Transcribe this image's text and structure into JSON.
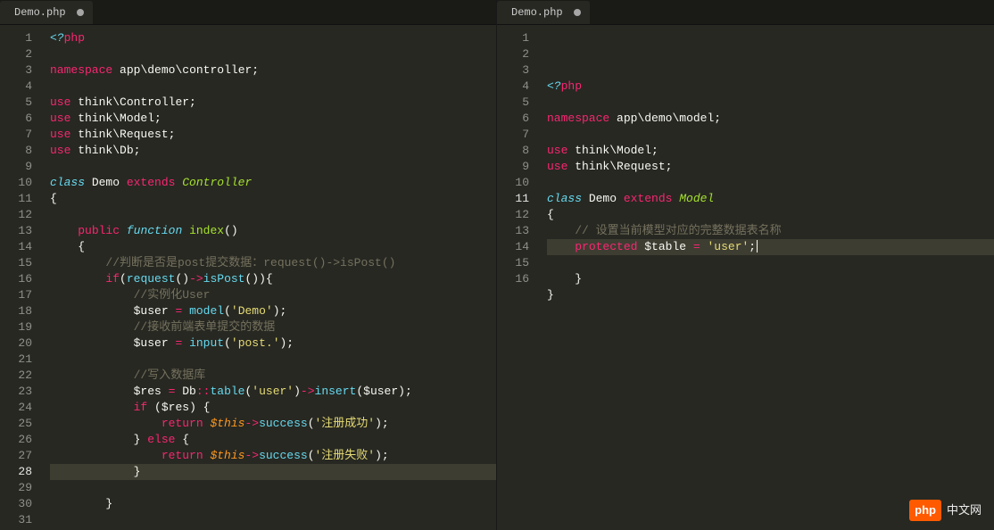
{
  "left": {
    "tab": {
      "label": "Demo.php",
      "dirty": true
    },
    "activeLine": 28,
    "lines": [
      [
        [
          "kw",
          "<?"
        ],
        [
          "kw2",
          "php"
        ]
      ],
      [],
      [
        [
          "kw2",
          "namespace"
        ],
        [
          "name",
          " app"
        ],
        [
          "punc",
          "\\"
        ],
        [
          "name",
          "demo"
        ],
        [
          "punc",
          "\\"
        ],
        [
          "name",
          "controller"
        ],
        [
          "punc",
          ";"
        ]
      ],
      [],
      [
        [
          "kw2",
          "use"
        ],
        [
          "name",
          " think"
        ],
        [
          "punc",
          "\\"
        ],
        [
          "name",
          "Controller"
        ],
        [
          "punc",
          ";"
        ]
      ],
      [
        [
          "kw2",
          "use"
        ],
        [
          "name",
          " think"
        ],
        [
          "punc",
          "\\"
        ],
        [
          "name",
          "Model"
        ],
        [
          "punc",
          ";"
        ]
      ],
      [
        [
          "kw2",
          "use"
        ],
        [
          "name",
          " think"
        ],
        [
          "punc",
          "\\"
        ],
        [
          "name",
          "Request"
        ],
        [
          "punc",
          ";"
        ]
      ],
      [
        [
          "kw2",
          "use"
        ],
        [
          "name",
          " think"
        ],
        [
          "punc",
          "\\"
        ],
        [
          "name",
          "Db"
        ],
        [
          "punc",
          ";"
        ]
      ],
      [],
      [
        [
          "kw",
          "class "
        ],
        [
          "name",
          "Demo "
        ],
        [
          "kw2",
          "extends "
        ],
        [
          "ext",
          "Controller"
        ]
      ],
      [
        [
          "punc",
          "{"
        ]
      ],
      [],
      [
        [
          "name",
          "    "
        ],
        [
          "kw2",
          "public"
        ],
        [
          "name",
          " "
        ],
        [
          "fnkw",
          "function"
        ],
        [
          "name",
          " "
        ],
        [
          "fn",
          "index"
        ],
        [
          "punc",
          "()"
        ]
      ],
      [
        [
          "punc",
          "    {"
        ]
      ],
      [
        [
          "name",
          "        "
        ],
        [
          "com",
          "//判断是否是post提交数据：request()->isPost()"
        ]
      ],
      [
        [
          "name",
          "        "
        ],
        [
          "kw2",
          "if"
        ],
        [
          "punc",
          "("
        ],
        [
          "call",
          "request"
        ],
        [
          "punc",
          "()"
        ],
        [
          "op",
          "->"
        ],
        [
          "call",
          "isPost"
        ],
        [
          "punc",
          "()){"
        ]
      ],
      [
        [
          "name",
          "            "
        ],
        [
          "com",
          "//实例化User"
        ]
      ],
      [
        [
          "name",
          "            "
        ],
        [
          "var",
          "$user "
        ],
        [
          "op",
          "="
        ],
        [
          "name",
          " "
        ],
        [
          "call",
          "model"
        ],
        [
          "punc",
          "("
        ],
        [
          "str",
          "'Demo'"
        ],
        [
          "punc",
          ");"
        ]
      ],
      [
        [
          "name",
          "            "
        ],
        [
          "com",
          "//接收前端表单提交的数据"
        ]
      ],
      [
        [
          "name",
          "            "
        ],
        [
          "var",
          "$user "
        ],
        [
          "op",
          "="
        ],
        [
          "name",
          " "
        ],
        [
          "call",
          "input"
        ],
        [
          "punc",
          "("
        ],
        [
          "str",
          "'post.'"
        ],
        [
          "punc",
          ");"
        ]
      ],
      [],
      [
        [
          "name",
          "            "
        ],
        [
          "com",
          "//写入数据库"
        ]
      ],
      [
        [
          "name",
          "            "
        ],
        [
          "var",
          "$res "
        ],
        [
          "op",
          "="
        ],
        [
          "name",
          " Db"
        ],
        [
          "op",
          "::"
        ],
        [
          "call",
          "table"
        ],
        [
          "punc",
          "("
        ],
        [
          "str",
          "'user'"
        ],
        [
          "punc",
          ")"
        ],
        [
          "op",
          "->"
        ],
        [
          "call",
          "insert"
        ],
        [
          "punc",
          "("
        ],
        [
          "var",
          "$user"
        ],
        [
          "punc",
          ");"
        ]
      ],
      [
        [
          "name",
          "            "
        ],
        [
          "kw2",
          "if"
        ],
        [
          "name",
          " "
        ],
        [
          "punc",
          "("
        ],
        [
          "var",
          "$res"
        ],
        [
          "punc",
          ") {"
        ]
      ],
      [
        [
          "name",
          "                "
        ],
        [
          "kw2",
          "return"
        ],
        [
          "name",
          " "
        ],
        [
          "this",
          "$this"
        ],
        [
          "op",
          "->"
        ],
        [
          "call",
          "success"
        ],
        [
          "punc",
          "("
        ],
        [
          "str",
          "'注册成功'"
        ],
        [
          "punc",
          ");"
        ]
      ],
      [
        [
          "name",
          "            "
        ],
        [
          "punc",
          "} "
        ],
        [
          "kw2",
          "else"
        ],
        [
          "punc",
          " {"
        ]
      ],
      [
        [
          "name",
          "                "
        ],
        [
          "kw2",
          "return"
        ],
        [
          "name",
          " "
        ],
        [
          "this",
          "$this"
        ],
        [
          "op",
          "->"
        ],
        [
          "call",
          "success"
        ],
        [
          "punc",
          "("
        ],
        [
          "str",
          "'注册失败'"
        ],
        [
          "punc",
          ");"
        ]
      ],
      [
        [
          "punc",
          "            }"
        ]
      ],
      [],
      [
        [
          "punc",
          "        }"
        ]
      ],
      []
    ]
  },
  "right": {
    "tab": {
      "label": "Demo.php",
      "dirty": true
    },
    "activeLine": 11,
    "showCursor": true,
    "lines": [
      [
        [
          "kw",
          "<?"
        ],
        [
          "kw2",
          "php"
        ]
      ],
      [],
      [
        [
          "kw2",
          "namespace"
        ],
        [
          "name",
          " app"
        ],
        [
          "punc",
          "\\"
        ],
        [
          "name",
          "demo"
        ],
        [
          "punc",
          "\\"
        ],
        [
          "name",
          "model"
        ],
        [
          "punc",
          ";"
        ]
      ],
      [],
      [
        [
          "kw2",
          "use"
        ],
        [
          "name",
          " think"
        ],
        [
          "punc",
          "\\"
        ],
        [
          "name",
          "Model"
        ],
        [
          "punc",
          ";"
        ]
      ],
      [
        [
          "kw2",
          "use"
        ],
        [
          "name",
          " think"
        ],
        [
          "punc",
          "\\"
        ],
        [
          "name",
          "Request"
        ],
        [
          "punc",
          ";"
        ]
      ],
      [],
      [
        [
          "kw",
          "class "
        ],
        [
          "name",
          "Demo "
        ],
        [
          "kw2",
          "extends "
        ],
        [
          "ext",
          "Model"
        ]
      ],
      [
        [
          "punc",
          "{   "
        ]
      ],
      [
        [
          "name",
          "    "
        ],
        [
          "com",
          "// 设置当前模型对应的完整数据表名称"
        ]
      ],
      [
        [
          "name",
          "    "
        ],
        [
          "kw2",
          "protected"
        ],
        [
          "name",
          " "
        ],
        [
          "var",
          "$table "
        ],
        [
          "op",
          "="
        ],
        [
          "name",
          " "
        ],
        [
          "str",
          "'user'"
        ],
        [
          "punc",
          ";"
        ]
      ],
      [],
      [
        [
          "punc",
          "    }"
        ]
      ],
      [
        [
          "punc",
          "}"
        ]
      ],
      [],
      []
    ]
  },
  "watermark": {
    "badge": "php",
    "text": "中文网"
  }
}
